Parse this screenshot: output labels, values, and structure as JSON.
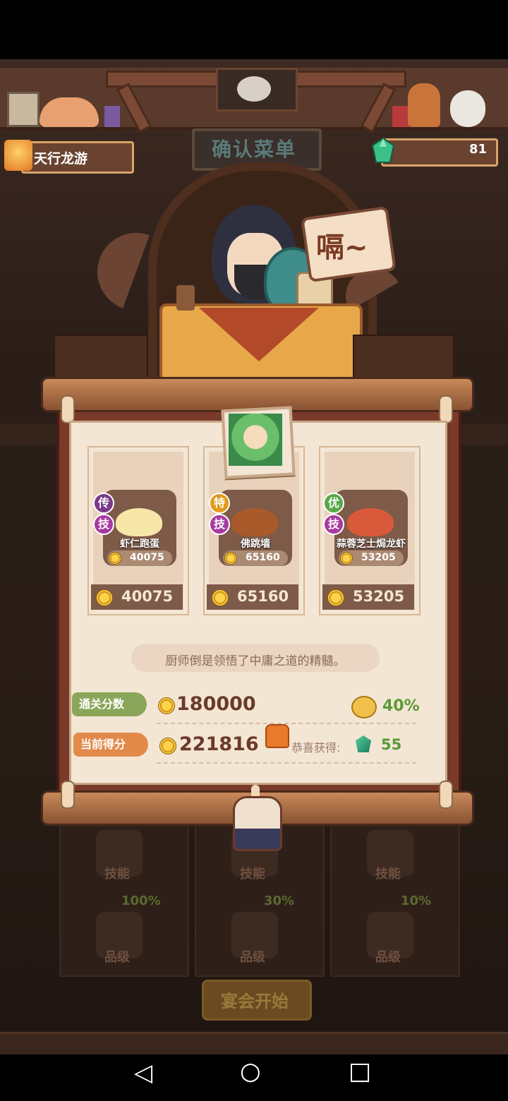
{
  "player": {
    "name": "天行龙游"
  },
  "currency": {
    "gems": "81"
  },
  "sign": {
    "title": "确认菜单"
  },
  "chef_bubble": {
    "text": "嗝~"
  },
  "dishes": [
    {
      "badge_top": "传",
      "badge_top_color": "#7a3a8a",
      "badge_bottom": "技",
      "name": "虾仁跑蛋",
      "coin_value": "40075",
      "price": "40075",
      "food_color": "#f6e7a8"
    },
    {
      "badge_top": "特",
      "badge_top_color": "#e09a1a",
      "badge_bottom": "技",
      "name": "佛跳墙",
      "coin_value": "65160",
      "price": "65160",
      "food_color": "#a85a2a"
    },
    {
      "badge_top": "优",
      "badge_top_color": "#5aa84a",
      "badge_bottom": "技",
      "name": "蒜蓉芝士焗龙虾",
      "coin_value": "53205",
      "price": "53205",
      "food_color": "#d85a3a"
    }
  ],
  "comment": "厨师倒是领悟了中庸之道的精髓。",
  "scores": {
    "pass_label": "通关分数",
    "pass_value": "180000",
    "bonus_pct": "40%",
    "current_label": "当前得分",
    "current_value": "221816",
    "reward_label": "恭喜获得:",
    "reward_value": "55"
  },
  "underneath": {
    "skill_labels": [
      "技能",
      "技能",
      "技能"
    ],
    "grade_labels": [
      "品级",
      "品级",
      "品级"
    ],
    "grade_pcts": [
      "100%",
      "30%",
      "10%"
    ],
    "start_button": "宴会开始"
  },
  "nav": {
    "back": "◁",
    "home": "○",
    "recent": "□"
  },
  "colors": {
    "accent_green": "#5a9a3a",
    "tag_green": "#8aa65a",
    "tag_orange": "#e28a4a",
    "score_text": "#6a3a2a"
  }
}
